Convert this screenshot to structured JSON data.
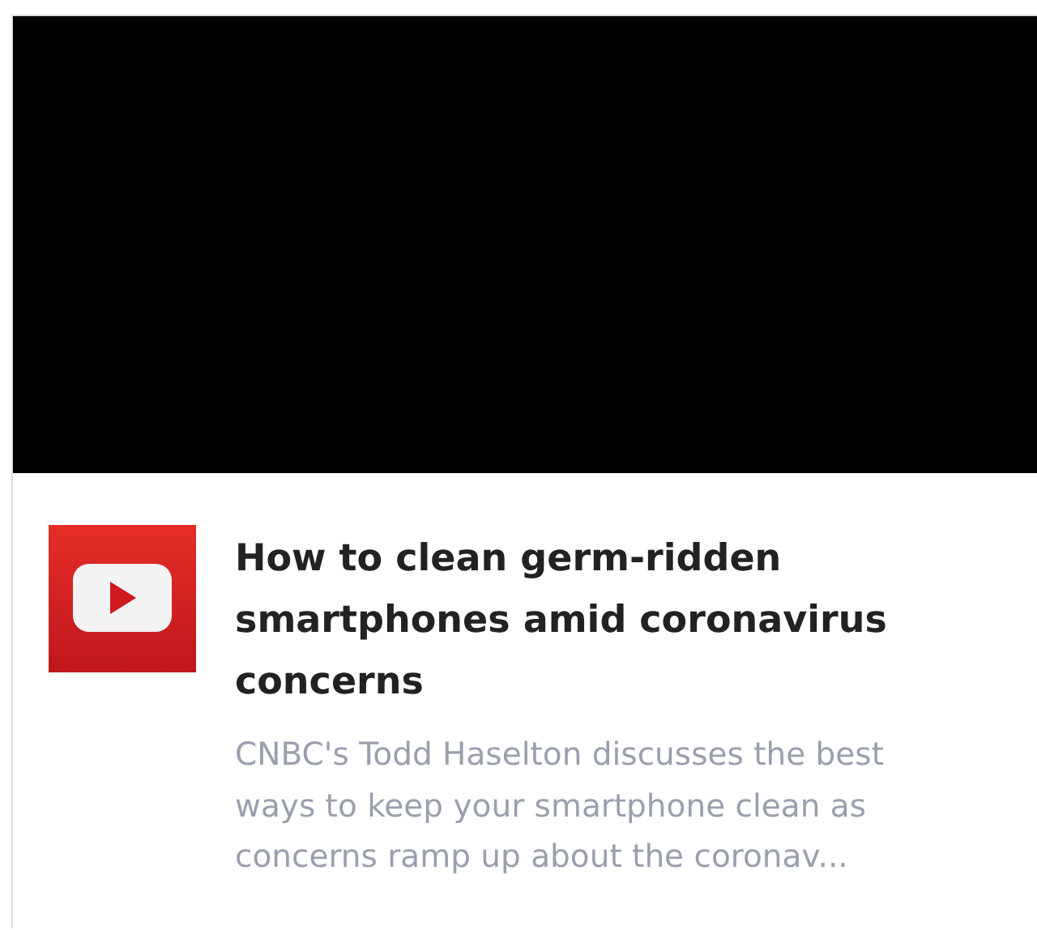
{
  "card": {
    "title": "How to clean germ-ridden smartphones amid coronavirus concerns",
    "description": "CNBC's Todd Haselton discusses the best ways to keep your smartphone clean as concerns ramp up about the coronav..."
  }
}
